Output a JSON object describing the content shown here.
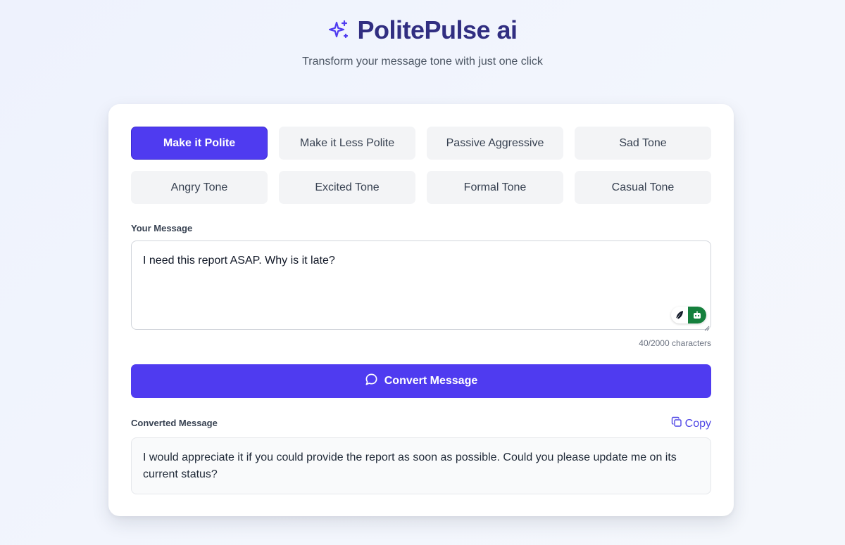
{
  "header": {
    "title": "PolitePulse ai",
    "tagline": "Transform your message tone with just one click",
    "icon": "sparkles-icon"
  },
  "tones": [
    {
      "label": "Make it Polite",
      "active": true
    },
    {
      "label": "Make it Less Polite",
      "active": false
    },
    {
      "label": "Passive Aggressive",
      "active": false
    },
    {
      "label": "Sad Tone",
      "active": false
    },
    {
      "label": "Angry Tone",
      "active": false
    },
    {
      "label": "Excited Tone",
      "active": false
    },
    {
      "label": "Formal Tone",
      "active": false
    },
    {
      "label": "Casual Tone",
      "active": false
    }
  ],
  "input": {
    "label": "Your Message",
    "value": "I need this report ASAP. Why is it late?",
    "char_count": "40/2000 characters"
  },
  "convert": {
    "label": "Convert Message",
    "icon": "chat-bubble-icon"
  },
  "output": {
    "label": "Converted Message",
    "copy_label": "Copy",
    "value": "I would appreciate it if you could provide the report as soon as possible. Could you please update me on its current status?"
  },
  "colors": {
    "accent": "#4f3bf0",
    "title": "#312e81",
    "extension_green": "#15803d"
  }
}
